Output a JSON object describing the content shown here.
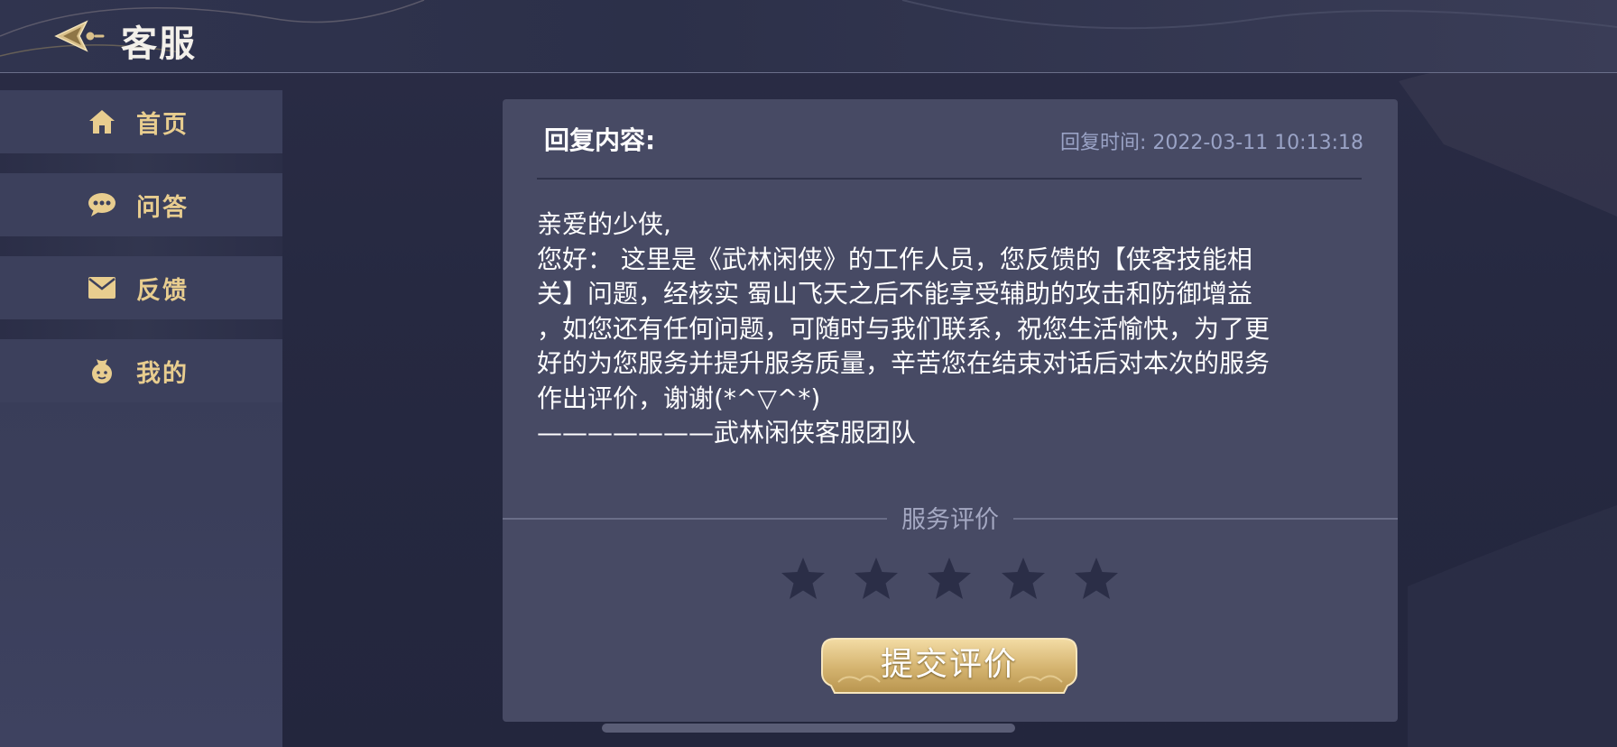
{
  "header": {
    "title": "客服",
    "back_icon": "back-arrow-icon"
  },
  "sidebar": {
    "items": [
      {
        "label": "首页",
        "icon": "home-icon"
      },
      {
        "label": "问答",
        "icon": "chat-bubble-icon"
      },
      {
        "label": "反馈",
        "icon": "envelope-icon"
      },
      {
        "label": "我的",
        "icon": "user-icon"
      }
    ]
  },
  "reply": {
    "heading": "回复内容:",
    "time": "回复时间: 2022-03-11 10:13:18",
    "lines": [
      "亲爱的少侠,",
      "您好： 这里是《武林闲侠》的工作人员，您反馈的【侠客技能相",
      "关】问题，经核实 蜀山飞天之后不能享受辅助的攻击和防御增益",
      "，如您还有任何问题，可随时与我们联系，祝您生活愉快，为了更",
      "好的为您服务并提升服务质量，辛苦您在结束对话后对本次的服务",
      "作出评价，谢谢(*^▽^*)",
      "———————武林闲侠客服团队"
    ]
  },
  "rating": {
    "label": "服务评价",
    "max_stars": 5,
    "selected_stars": 0,
    "star_color": "#2b2e47"
  },
  "submit": {
    "label": "提交评价"
  },
  "colors": {
    "accent_gold": "#e8cd8f",
    "panel_bg": "#474a64",
    "page_bg": "#262941"
  }
}
